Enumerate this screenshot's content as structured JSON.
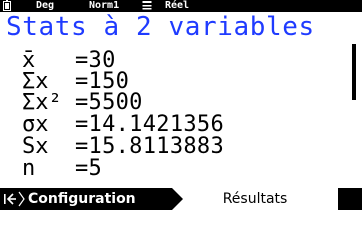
{
  "status_bar": {
    "angle_mode": "Deg",
    "display_mode": "Norm1",
    "number_mode": "Réel",
    "battery_icon": "battery-icon",
    "calc_icon": "table-icon"
  },
  "title": "Stats à 2 variables",
  "results": [
    {
      "label": "x̄",
      "value": "=30"
    },
    {
      "label": "Σx",
      "value": "=150"
    },
    {
      "label": "Σx²",
      "value": "=5500"
    },
    {
      "label": "σx",
      "value": "=14.1421356"
    },
    {
      "label": "Sx",
      "value": "=15.8113883"
    },
    {
      "label": "n",
      "value": "=5"
    }
  ],
  "tabs": {
    "back_icon": "back-to-start-icon",
    "configuration": "Configuration",
    "results": "Résultats"
  }
}
